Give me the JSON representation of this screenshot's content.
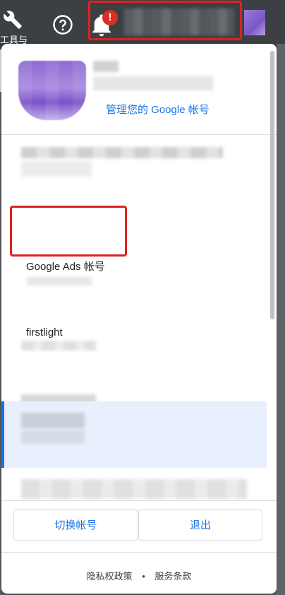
{
  "topbar": {
    "tools_label": "工具与",
    "icons": {
      "tools": "wrench-icon",
      "help": "help-circle-icon",
      "notifications": "bell-icon"
    },
    "badge_text": "!"
  },
  "panel": {
    "manage_account": "管理您的 Google 帐号",
    "accounts": [
      {
        "title": "Google Ads 帐号"
      },
      {
        "title": "firstlight"
      }
    ],
    "buttons": {
      "switch_account": "切换帐号",
      "sign_out": "退出"
    },
    "legal": {
      "privacy": "隐私权政策",
      "separator": "•",
      "terms": "服务条款"
    }
  },
  "colors": {
    "accent": "#1a73e8",
    "selected_bg": "#e8f0fe",
    "badge_red": "#d93025",
    "highlight_red": "#e02020"
  }
}
